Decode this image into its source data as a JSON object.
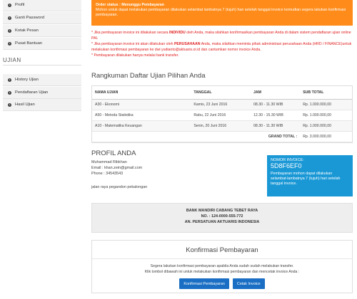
{
  "sidebar": {
    "top_items": [
      {
        "label": "Profil"
      },
      {
        "label": "Ganti Password"
      },
      {
        "label": "Kotak Pesan"
      },
      {
        "label": "Pusat Bantuan"
      }
    ],
    "section_title": "UJIAN",
    "ujian_items": [
      {
        "label": "History Ujian"
      },
      {
        "label": "Pendaftaran Ujian"
      },
      {
        "label": "Hasil Ujian"
      }
    ]
  },
  "alert": {
    "status": "Order status : Menunggu Pembayaran",
    "message": "Mohon untuk dapat melakukan pembayaran dilakukan selambat lambatnya 7 (tujuh) hari setelah tanggal invoice kemudian segera lakukan konfirmasi pembayaran."
  },
  "notes": {
    "line1_pre": "* Jika pembayaran invoice ini dilakukan secara ",
    "line1_bold": "INDIVIDU",
    "line1_post": " oleh Anda, maka silahkan konfirmasikan pembayaran Anda di dalam sistem pendaftaran ujian online PAI.",
    "line2_pre": "* Jika pembayaran invoice ini akan dilakukan oleh ",
    "line2_bold": "PERUSAHAAN",
    "line2_post": " Anda, maka silahkan meminta pihak administrasi perusahaan Anda (HRD / FINANCE)untuk melakukan konfirmasi pembayaran ke dwi yudianto@aktuaris.or.id dan cantumkan nomor invoice Anda.",
    "line3": "* Pembayaran dilakukan hanya melalui bank transfer."
  },
  "summary": {
    "title": "Rangkuman Daftar Ujian Pilihan Anda",
    "headers": {
      "name": "NAMA UJIAN",
      "date": "TANGGAL",
      "time": "JAM",
      "subtotal": "SUB TOTAL"
    },
    "rows": [
      {
        "name": "A30 - Ekonomi",
        "date": "Kamis, 23 Juni 2016",
        "time": "08.30 - 11.30 WIB",
        "subtotal": "Rp. 1.000.000,00"
      },
      {
        "name": "A50 - Metoda Statistika",
        "date": "Rabu, 22 Juni 2016",
        "time": "12.30 - 15.30 WIB",
        "subtotal": "Rp. 1.000.000,00"
      },
      {
        "name": "A10 - Matematika Keuangan",
        "date": "Senin, 20 Juni 2016",
        "time": "08.30 - 11.30 WIB",
        "subtotal": "Rp. 1.000.000,00"
      }
    ],
    "grand_total_label": "GRAND TOTAL :",
    "grand_total_value": "Rp. 3.000.000,00"
  },
  "profile": {
    "title": "PROFIL ANDA",
    "name": "Muhammad Ribkhan",
    "email": "Email : khan.zein@gmail.com",
    "phone": "Phone : 34543543",
    "address": "jalan raya pegandon pekalongan"
  },
  "invoice": {
    "label": "NOMOR INVOICE:",
    "number": "5D8F6EF0",
    "note": "Pembayaran mohon dapat dilakukan selambat-lambatnya 7 (tujuh) hari setelah tanggal invoice."
  },
  "bank": {
    "name": "BANK MANDIRI CABANG TEBET RAYA",
    "account": "NO. : 124-0000-555-772",
    "holder": "AN. PERSATUAN AKTUARIS INDONESIA"
  },
  "confirm": {
    "title": "Konfirmasi Pembayaran",
    "line1": "Segera lakukan konfirmasi pembayaran apabila Anda sudah sudah melakukan transfer.",
    "line2": "Klik tombol dibawah ini untuk melakukan konfirmasi pembayaran dan mencetak invoice Anda :",
    "button_confirm": "Konfirmasi Pembayaran",
    "button_print": "Cetak Invoice"
  },
  "colors": {
    "alert": "#ff8c1a",
    "invoice": "#1a98d6",
    "button": "#1a6fc4",
    "note": "#e02020"
  }
}
